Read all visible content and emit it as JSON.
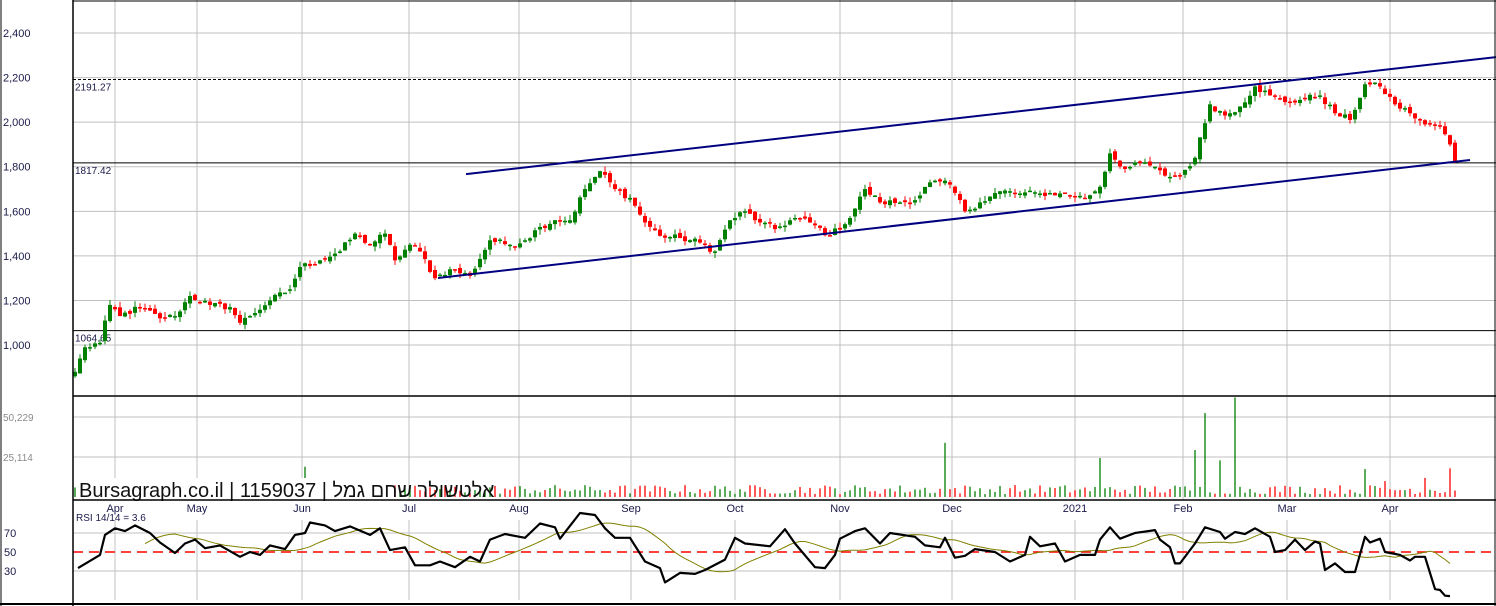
{
  "chart_data": {
    "type": "candlestick",
    "watermark": "Bursagraph.co.il | 1159037 | אלטשולר שחם גמל",
    "x_axis": {
      "unit": "trading-day index",
      "range": [
        0,
        277
      ],
      "ticks": [
        {
          "day": 8,
          "label": "Apr"
        },
        {
          "day": 24.4,
          "label": "May"
        },
        {
          "day": 45.4,
          "label": "Jun"
        },
        {
          "day": 66.8,
          "label": "Jul"
        },
        {
          "day": 88.8,
          "label": "Aug"
        },
        {
          "day": 111.2,
          "label": "Sep"
        },
        {
          "day": 132,
          "label": "Oct"
        },
        {
          "day": 153,
          "label": "Nov"
        },
        {
          "day": 175.4,
          "label": "Dec"
        },
        {
          "day": 200,
          "label": "2021"
        },
        {
          "day": 221.6,
          "label": "Feb"
        },
        {
          "day": 242.4,
          "label": "Mar"
        },
        {
          "day": 263,
          "label": "Apr"
        }
      ]
    },
    "price": {
      "ylim": [
        800,
        2550
      ],
      "ticks": [
        "2,400",
        "2,200",
        "2,000",
        "1,800",
        "1,600",
        "1,400",
        "1,200",
        "1,000"
      ],
      "tick_values": [
        2400,
        2200,
        2000,
        1800,
        1600,
        1400,
        1200,
        1000
      ],
      "colors": {
        "up": "#008000",
        "down": "#ff0000"
      },
      "close_anchors": [
        [
          0,
          880
        ],
        [
          2,
          990
        ],
        [
          5,
          1010
        ],
        [
          7,
          1180
        ],
        [
          9,
          1130
        ],
        [
          13,
          1170
        ],
        [
          17,
          1120
        ],
        [
          20,
          1130
        ],
        [
          23,
          1220
        ],
        [
          27,
          1180
        ],
        [
          31,
          1170
        ],
        [
          33,
          1100
        ],
        [
          35,
          1130
        ],
        [
          39,
          1200
        ],
        [
          43,
          1250
        ],
        [
          45,
          1350
        ],
        [
          49,
          1380
        ],
        [
          53,
          1420
        ],
        [
          56,
          1500
        ],
        [
          59,
          1450
        ],
        [
          62,
          1500
        ],
        [
          64,
          1380
        ],
        [
          67,
          1450
        ],
        [
          69,
          1420
        ],
        [
          72,
          1300
        ],
        [
          75,
          1340
        ],
        [
          79,
          1310
        ],
        [
          83,
          1470
        ],
        [
          87,
          1450
        ],
        [
          90,
          1470
        ],
        [
          93,
          1530
        ],
        [
          96,
          1560
        ],
        [
          99,
          1560
        ],
        [
          102,
          1700
        ],
        [
          105,
          1780
        ],
        [
          108,
          1700
        ],
        [
          111,
          1660
        ],
        [
          114,
          1550
        ],
        [
          117,
          1490
        ],
        [
          121,
          1480
        ],
        [
          125,
          1460
        ],
        [
          128,
          1420
        ],
        [
          131,
          1560
        ],
        [
          134,
          1600
        ],
        [
          137,
          1550
        ],
        [
          140,
          1520
        ],
        [
          144,
          1570
        ],
        [
          147,
          1550
        ],
        [
          151,
          1490
        ],
        [
          155,
          1570
        ],
        [
          158,
          1700
        ],
        [
          161,
          1640
        ],
        [
          165,
          1640
        ],
        [
          168,
          1650
        ],
        [
          171,
          1730
        ],
        [
          175,
          1720
        ],
        [
          178,
          1600
        ],
        [
          181,
          1640
        ],
        [
          185,
          1690
        ],
        [
          189,
          1680
        ],
        [
          193,
          1680
        ],
        [
          197,
          1680
        ],
        [
          202,
          1660
        ],
        [
          205,
          1710
        ],
        [
          207,
          1860
        ],
        [
          210,
          1790
        ],
        [
          214,
          1820
        ],
        [
          218,
          1760
        ],
        [
          221,
          1760
        ],
        [
          224,
          1840
        ],
        [
          227,
          2080
        ],
        [
          230,
          2030
        ],
        [
          233,
          2070
        ],
        [
          236,
          2160
        ],
        [
          239,
          2120
        ],
        [
          242,
          2090
        ],
        [
          245,
          2100
        ],
        [
          249,
          2120
        ],
        [
          252,
          2040
        ],
        [
          255,
          2010
        ],
        [
          258,
          2170
        ],
        [
          261,
          2160
        ],
        [
          264,
          2080
        ],
        [
          267,
          2040
        ],
        [
          270,
          1990
        ],
        [
          273,
          1980
        ],
        [
          275,
          1900
        ],
        [
          276,
          1820
        ]
      ],
      "levels": [
        {
          "value": 2191.27,
          "label": "2191.27",
          "style": "dashed"
        },
        {
          "value": 1817.42,
          "label": "1817.42",
          "style": "solid"
        },
        {
          "value": 1064.65,
          "label": "1064.65",
          "style": "solid"
        }
      ],
      "trendlines": [
        {
          "name": "upper-channel",
          "from": [
            78.2,
            1767
          ],
          "to": [
            284.2,
            2292
          ],
          "color": "#000080"
        },
        {
          "name": "lower-channel",
          "from": [
            72.6,
            1301
          ],
          "to": [
            279,
            1830
          ],
          "color": "#000080"
        }
      ]
    },
    "volume": {
      "ylim": [
        0,
        62000
      ],
      "ticks": [
        "50,229",
        "25,114"
      ],
      "tick_values": [
        50229,
        25114
      ],
      "base_level": 4500,
      "spikes": [
        [
          0,
          6000
        ],
        [
          3,
          6500
        ],
        [
          5,
          6000
        ],
        [
          8,
          6500
        ],
        [
          40,
          8500
        ],
        [
          46,
          19000
        ],
        [
          51,
          8500
        ],
        [
          56,
          9000
        ],
        [
          62,
          7500
        ],
        [
          174,
          34000
        ],
        [
          205,
          24500
        ],
        [
          224,
          29500
        ],
        [
          226,
          52700
        ],
        [
          229,
          23000
        ],
        [
          232,
          62800
        ],
        [
          258,
          17500
        ],
        [
          262,
          10000
        ],
        [
          270,
          12000
        ],
        [
          275,
          18000
        ]
      ]
    },
    "rsi": {
      "label": "RSI 14/14 = 3.6",
      "period": 14,
      "ma_period": 14,
      "ylim": [
        0,
        100
      ],
      "ticks": [
        "70",
        "50",
        "30"
      ],
      "tick_values": [
        70,
        50,
        30
      ],
      "midline": 50,
      "colors": {
        "rsi": "#000000",
        "ma": "#808000",
        "midline": "#ff0000"
      },
      "anchors": [
        [
          0.6,
          33
        ],
        [
          5,
          47
        ],
        [
          6,
          68
        ],
        [
          8,
          75
        ],
        [
          10,
          72
        ],
        [
          12,
          78
        ],
        [
          15,
          70
        ],
        [
          17,
          60
        ],
        [
          20,
          49
        ],
        [
          22,
          59
        ],
        [
          24,
          63
        ],
        [
          26,
          54
        ],
        [
          29,
          57
        ],
        [
          33,
          45
        ],
        [
          35,
          50
        ],
        [
          37,
          47
        ],
        [
          39,
          57
        ],
        [
          42,
          53
        ],
        [
          44,
          68
        ],
        [
          46,
          70
        ],
        [
          47,
          81
        ],
        [
          50,
          78
        ],
        [
          52,
          72
        ],
        [
          55,
          77
        ],
        [
          59,
          68
        ],
        [
          61,
          75
        ],
        [
          63,
          52
        ],
        [
          66,
          55
        ],
        [
          68,
          36
        ],
        [
          71,
          36
        ],
        [
          73,
          40
        ],
        [
          76,
          34
        ],
        [
          79,
          45
        ],
        [
          81,
          40
        ],
        [
          83,
          63
        ],
        [
          86,
          69
        ],
        [
          90,
          65
        ],
        [
          93,
          80
        ],
        [
          96,
          76
        ],
        [
          97,
          64
        ],
        [
          101,
          91
        ],
        [
          104,
          89
        ],
        [
          106,
          75
        ],
        [
          108,
          65
        ],
        [
          111,
          65
        ],
        [
          114,
          40
        ],
        [
          117,
          33
        ],
        [
          118,
          18
        ],
        [
          121,
          28
        ],
        [
          124,
          27
        ],
        [
          126,
          31
        ],
        [
          130,
          42
        ],
        [
          132,
          65
        ],
        [
          134,
          59
        ],
        [
          139,
          56
        ],
        [
          142,
          74
        ],
        [
          144,
          59
        ],
        [
          148,
          34
        ],
        [
          150,
          33
        ],
        [
          152,
          47
        ],
        [
          153,
          64
        ],
        [
          156,
          72
        ],
        [
          158,
          75
        ],
        [
          161,
          59
        ],
        [
          163,
          70
        ],
        [
          168,
          66
        ],
        [
          170,
          57
        ],
        [
          173,
          55
        ],
        [
          174,
          65
        ],
        [
          176,
          44
        ],
        [
          178,
          46
        ],
        [
          180,
          53
        ],
        [
          184,
          50
        ],
        [
          187,
          40
        ],
        [
          190,
          47
        ],
        [
          191,
          66
        ],
        [
          193,
          56
        ],
        [
          196,
          59
        ],
        [
          198,
          40
        ],
        [
          201,
          47
        ],
        [
          204,
          47
        ],
        [
          205,
          63
        ],
        [
          207,
          76
        ],
        [
          209,
          64
        ],
        [
          212,
          70
        ],
        [
          216,
          73
        ],
        [
          217,
          63
        ],
        [
          219,
          55
        ],
        [
          220,
          38
        ],
        [
          221,
          38
        ],
        [
          224,
          59
        ],
        [
          226,
          76
        ],
        [
          229,
          71
        ],
        [
          230,
          64
        ],
        [
          232,
          71
        ],
        [
          234,
          69
        ],
        [
          236,
          75
        ],
        [
          239,
          66
        ],
        [
          240,
          50
        ],
        [
          242,
          52
        ],
        [
          244,
          63
        ],
        [
          246,
          52
        ],
        [
          248,
          61
        ],
        [
          249,
          59
        ],
        [
          250,
          31
        ],
        [
          252,
          38
        ],
        [
          254,
          29
        ],
        [
          256,
          29
        ],
        [
          258,
          66
        ],
        [
          259,
          60
        ],
        [
          261,
          64
        ],
        [
          262,
          50
        ],
        [
          265,
          47
        ],
        [
          267,
          41
        ],
        [
          268,
          45
        ],
        [
          270,
          45
        ],
        [
          272,
          11
        ],
        [
          273,
          10
        ],
        [
          274,
          4
        ],
        [
          275,
          3.6
        ]
      ]
    }
  }
}
